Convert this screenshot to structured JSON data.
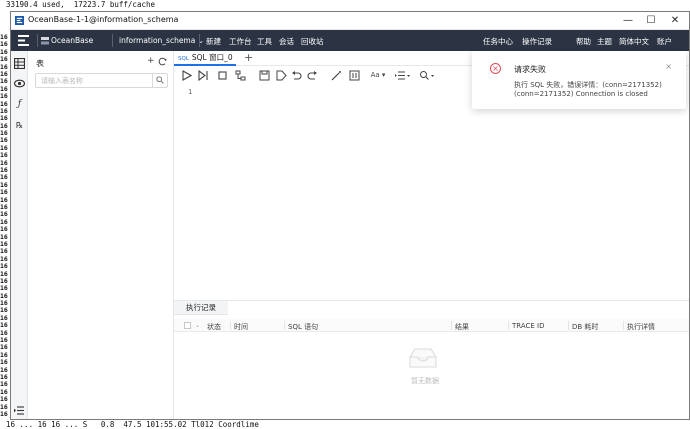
{
  "terminal": {
    "lines": [
      "33190.4 used,  17223.7 buff/cache",
      "16 ... 16 16 ... S   0.8  47.5 101:55.02 Tl012 Coordlime"
    ],
    "gutter": [
      "16",
      "16",
      "16",
      "16",
      "16",
      "16",
      "16",
      "16",
      "16",
      "16",
      "16",
      "16",
      "16",
      "16",
      "16",
      "16",
      "16",
      "16",
      "16",
      "16",
      "16",
      "16",
      "16",
      "16",
      "16",
      "16",
      "16",
      "16",
      "16",
      "16",
      "16",
      "16",
      "16",
      "16",
      "16",
      "16",
      "16",
      "16",
      "16",
      "16",
      "16",
      "16",
      "16",
      "16",
      "16",
      "16",
      "16",
      "16",
      "16",
      "16",
      "16",
      "16"
    ]
  },
  "window": {
    "title": "OceanBase-1-1@information_schema",
    "controls": {
      "minimize": "—",
      "maximize": "☐",
      "close": "✕"
    }
  },
  "topbar": {
    "brand": "OceanBase",
    "db_selector": "information_schema ⌄",
    "menu": [
      "新建",
      "工作台",
      "工具",
      "会话",
      "回收站"
    ],
    "right_menu": [
      "任务中心",
      "操作记录",
      "帮助",
      "主题",
      "简体中文",
      "账户"
    ]
  },
  "sidebar": {
    "header": "表",
    "search_placeholder": "请输入表名称",
    "icons": [
      "table-icon",
      "eye-icon",
      "function-icon",
      "procedure-icon"
    ]
  },
  "editor": {
    "tab_label": "SQL 窗口_0",
    "tab_badge": "SQL",
    "line_numbers": [
      "1"
    ],
    "format_label": "Aa"
  },
  "results": {
    "tab_label": "执行记录",
    "columns": [
      "状态",
      "时间",
      "SQL 语句",
      "结果",
      "TRACE ID",
      "DB 耗时",
      "执行详情"
    ],
    "empty_text": "暂无数据"
  },
  "notification": {
    "title": "请求失败",
    "line1": "执行 SQL 失败，错误详情：(conn=2171352)",
    "line2": "(conn=2171352) Connection is closed",
    "close": "×"
  },
  "colors": {
    "topbar_bg": "#2c3444",
    "accent": "#1f6feb",
    "error": "#e34d59"
  }
}
